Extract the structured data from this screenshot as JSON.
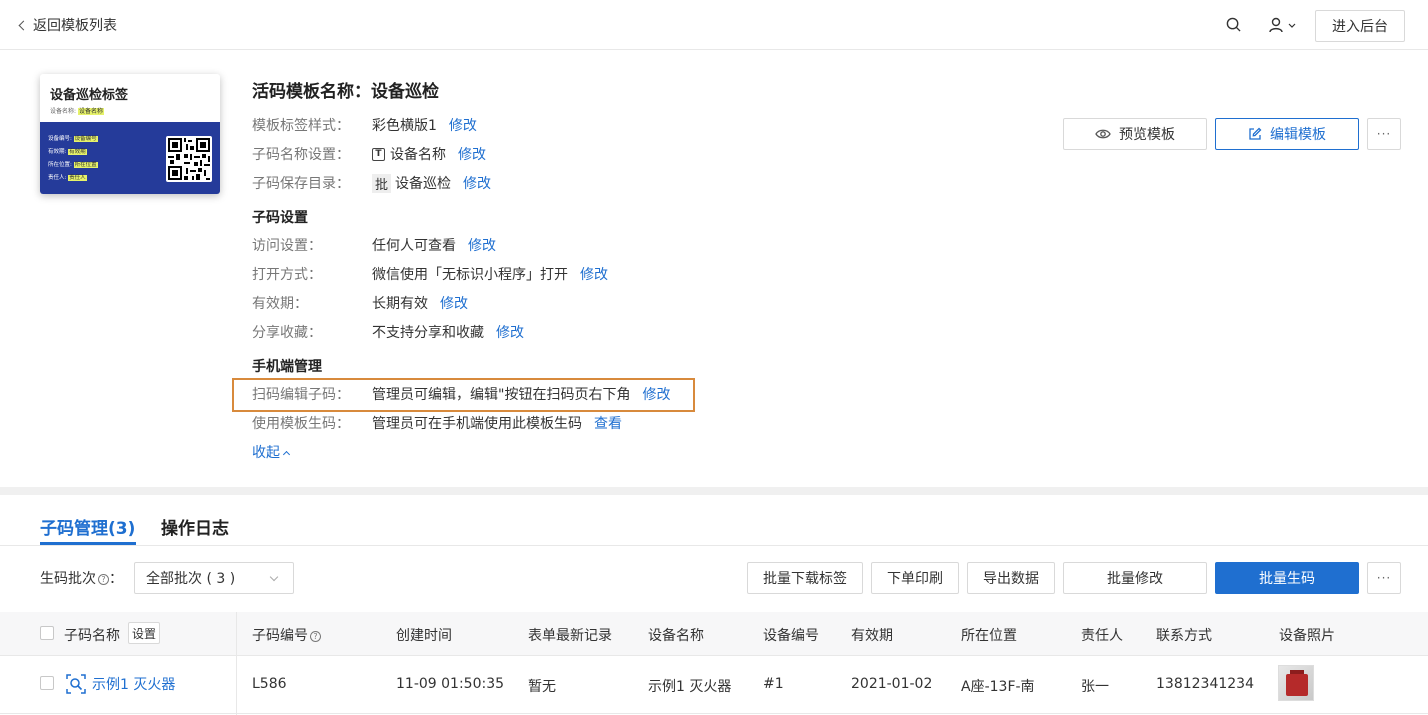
{
  "header": {
    "back_label": "返回模板列表",
    "backend_button": "进入后台"
  },
  "thumbnail": {
    "title": "设备巡检标签",
    "sub_label": "设备名称:",
    "sub_value": "设备名称",
    "rows": [
      {
        "label": "设备编号:",
        "value": "设备编号"
      },
      {
        "label": "有效期:",
        "value": "有效期"
      },
      {
        "label": "所在位置:",
        "value": "所在位置"
      },
      {
        "label": "责任人:",
        "value": "责任人"
      }
    ]
  },
  "template": {
    "title": "活码模板名称：设备巡检",
    "edit_label": "修改",
    "style": {
      "label": "模板标签样式：",
      "value": "彩色横版1"
    },
    "name_setting": {
      "label": "子码名称设置：",
      "value": "设备名称",
      "badge": "T"
    },
    "save_dir": {
      "label": "子码保存目录：",
      "value": "设备巡检",
      "badge": "批"
    },
    "sub_settings_title": "子码设置",
    "access": {
      "label": "访问设置：",
      "value": "任何人可查看"
    },
    "open_mode": {
      "label": "打开方式：",
      "value": "微信使用「无标识小程序」打开"
    },
    "validity": {
      "label": "有效期：",
      "value": "长期有效"
    },
    "share": {
      "label": "分享收藏：",
      "value": "不支持分享和收藏"
    },
    "mobile_title": "手机端管理",
    "scan_edit": {
      "label": "扫码编辑子码：",
      "value": "管理员可编辑，编辑\"按钮在扫码页右下角"
    },
    "use_template": {
      "label": "使用模板生码：",
      "value": "管理员可在手机端使用此模板生码",
      "action": "查看"
    },
    "collapse_label": "收起"
  },
  "actions": {
    "preview": "预览模板",
    "edit": "编辑模板",
    "more": "···"
  },
  "tabs": [
    {
      "label": "子码管理(3)",
      "active": true
    },
    {
      "label": "操作日志",
      "active": false
    }
  ],
  "toolbar": {
    "batch_label": "生码批次",
    "batch_select": "全部批次 ( 3 )",
    "download_labels": "批量下载标签",
    "print_order": "下单印刷",
    "export": "导出数据",
    "batch_modify": "批量修改",
    "batch_generate": "批量生码",
    "more": "···"
  },
  "table": {
    "settings_badge": "设置",
    "columns": [
      "子码名称",
      "子码编号",
      "创建时间",
      "表单最新记录",
      "设备名称",
      "设备编号",
      "有效期",
      "所在位置",
      "责任人",
      "联系方式",
      "设备照片"
    ],
    "rows": [
      {
        "name": "示例1 灭火器",
        "code": "L586",
        "created": "11-09 01:50:35",
        "latest_record": "暂无",
        "device_name": "示例1 灭火器",
        "device_no": "#1",
        "validity": "2021-01-02",
        "location": "A座-13F-南",
        "owner": "张一",
        "contact": "13812341234"
      }
    ]
  },
  "colors": {
    "accent": "#1f6fd0",
    "highlight_border": "#d88a3c",
    "card_blue": "#253b9a"
  }
}
